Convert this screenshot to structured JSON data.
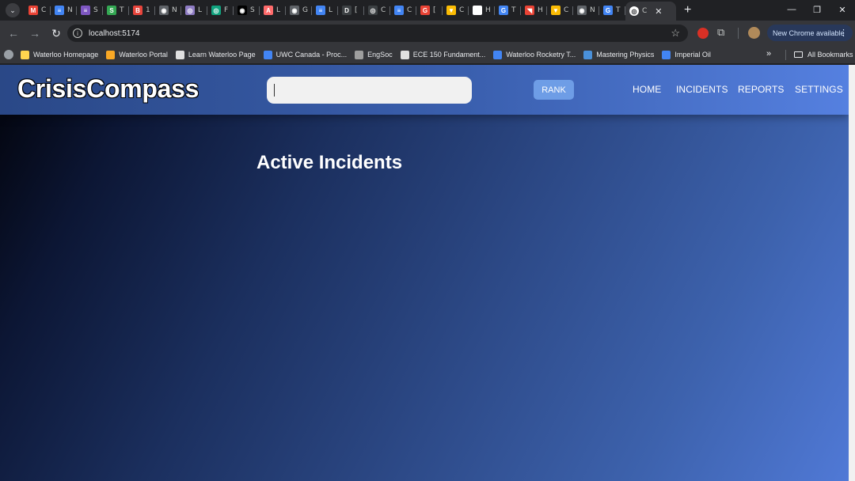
{
  "browser": {
    "tabs": [
      {
        "icon": "gmail-icon",
        "color": "#ea4335",
        "glyph": "M",
        "text": "C"
      },
      {
        "icon": "docs-icon",
        "color": "#4285f4",
        "glyph": "≡",
        "text": "N"
      },
      {
        "icon": "forms-icon",
        "color": "#7e57c2",
        "glyph": "≡",
        "text": "S"
      },
      {
        "icon": "app-icon",
        "color": "#34a853",
        "glyph": "S",
        "text": "T"
      },
      {
        "icon": "app-icon",
        "color": "#e8453c",
        "glyph": "B",
        "text": "1"
      },
      {
        "icon": "globe-icon",
        "color": "#5f6368",
        "glyph": "◉",
        "text": "N"
      },
      {
        "icon": "app-icon",
        "color": "#8e7cc3",
        "glyph": "◎",
        "text": "L"
      },
      {
        "icon": "app-icon",
        "color": "#10a37f",
        "glyph": "◎",
        "text": "F"
      },
      {
        "icon": "github-icon",
        "color": "#000000",
        "glyph": "◉",
        "text": "S"
      },
      {
        "icon": "app-icon",
        "color": "#ff6b6b",
        "glyph": "A",
        "text": "L"
      },
      {
        "icon": "globe-icon",
        "color": "#5f6368",
        "glyph": "◉",
        "text": "G"
      },
      {
        "icon": "docs-icon",
        "color": "#4285f4",
        "glyph": "≡",
        "text": "L"
      },
      {
        "icon": "app-icon",
        "color": "#3c4043",
        "glyph": "D",
        "text": "["
      },
      {
        "icon": "app-icon",
        "color": "#3c4043",
        "glyph": "◎",
        "text": "C"
      },
      {
        "icon": "docs-icon",
        "color": "#4285f4",
        "glyph": "≡",
        "text": "C"
      },
      {
        "icon": "app-icon",
        "color": "#ea4335",
        "glyph": "G",
        "text": "["
      },
      {
        "icon": "app-icon",
        "color": "#fbbc04",
        "glyph": "▼",
        "text": "C"
      },
      {
        "icon": "app-icon",
        "color": "#ffffff",
        "glyph": "◉",
        "text": "H"
      },
      {
        "icon": "google-icon",
        "color": "#4285f4",
        "glyph": "G",
        "text": "T"
      },
      {
        "icon": "app-icon",
        "color": "#ea4335",
        "glyph": "◥",
        "text": "H"
      },
      {
        "icon": "app-icon",
        "color": "#fbbc04",
        "glyph": "▼",
        "text": "C"
      },
      {
        "icon": "globe-icon",
        "color": "#5f6368",
        "glyph": "◉",
        "text": "N"
      },
      {
        "icon": "google-icon",
        "color": "#4285f4",
        "glyph": "G",
        "text": "T"
      }
    ],
    "active_tab": {
      "icon": "app-icon",
      "color": "#ffffff",
      "text": "C"
    },
    "url": "localhost:5174",
    "update_label": "New Chrome available",
    "bookmarks": [
      {
        "label": "Waterloo Homepage",
        "icon": "waterloo-icon",
        "color": "#ffd54f"
      },
      {
        "label": "Waterloo Portal",
        "icon": "portal-icon",
        "color": "#f9a825"
      },
      {
        "label": "Learn Waterloo Page",
        "icon": "learn-icon",
        "color": "#e0e0e0"
      },
      {
        "label": "UWC Canada - Proc...",
        "icon": "uwc-icon",
        "color": "#4285f4"
      },
      {
        "label": "EngSoc",
        "icon": "engsoc-icon",
        "color": "#9e9e9e"
      },
      {
        "label": "ECE 150 Fundament...",
        "icon": "ece-icon",
        "color": "#e0e0e0"
      },
      {
        "label": "Waterloo Rocketry T...",
        "icon": "docs-icon",
        "color": "#4285f4"
      },
      {
        "label": "Mastering Physics",
        "icon": "physics-icon",
        "color": "#4a90d9"
      },
      {
        "label": "Imperial Oil",
        "icon": "imperial-icon",
        "color": "#4285f4"
      }
    ],
    "all_bookmarks": "All Bookmarks"
  },
  "app": {
    "logo": "CrisisCompass",
    "search_value": "",
    "rank_label": "RANK",
    "nav": [
      "HOME",
      "INCIDENTS",
      "REPORTS",
      "SETTINGS"
    ],
    "page_title": "Active Incidents"
  }
}
